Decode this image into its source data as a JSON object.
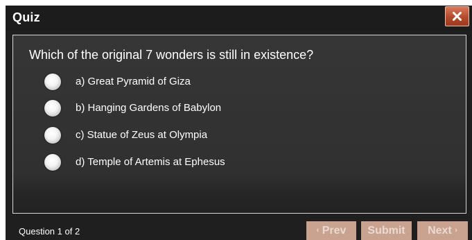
{
  "window": {
    "title": "Quiz",
    "close_icon": "close-icon"
  },
  "quiz": {
    "question": "Which of the original 7 wonders is still in existence?",
    "options": [
      {
        "label": "a) Great Pyramid of Giza",
        "selected": false
      },
      {
        "label": "b) Hanging Gardens of Babylon",
        "selected": false
      },
      {
        "label": "c) Statue of Zeus at Olympia",
        "selected": false
      },
      {
        "label": "d) Temple of Artemis at Ephesus",
        "selected": false
      }
    ]
  },
  "footer": {
    "progress": "Question 1 of 2",
    "prev_label": "Prev",
    "submit_label": "Submit",
    "next_label": "Next",
    "prev_icon": "chevron-left-icon",
    "next_icon": "chevron-right-icon"
  },
  "colors": {
    "dialog_bg": "#1f1f1f",
    "close_button": "#b34a2d",
    "nav_button": "#c9a290"
  }
}
